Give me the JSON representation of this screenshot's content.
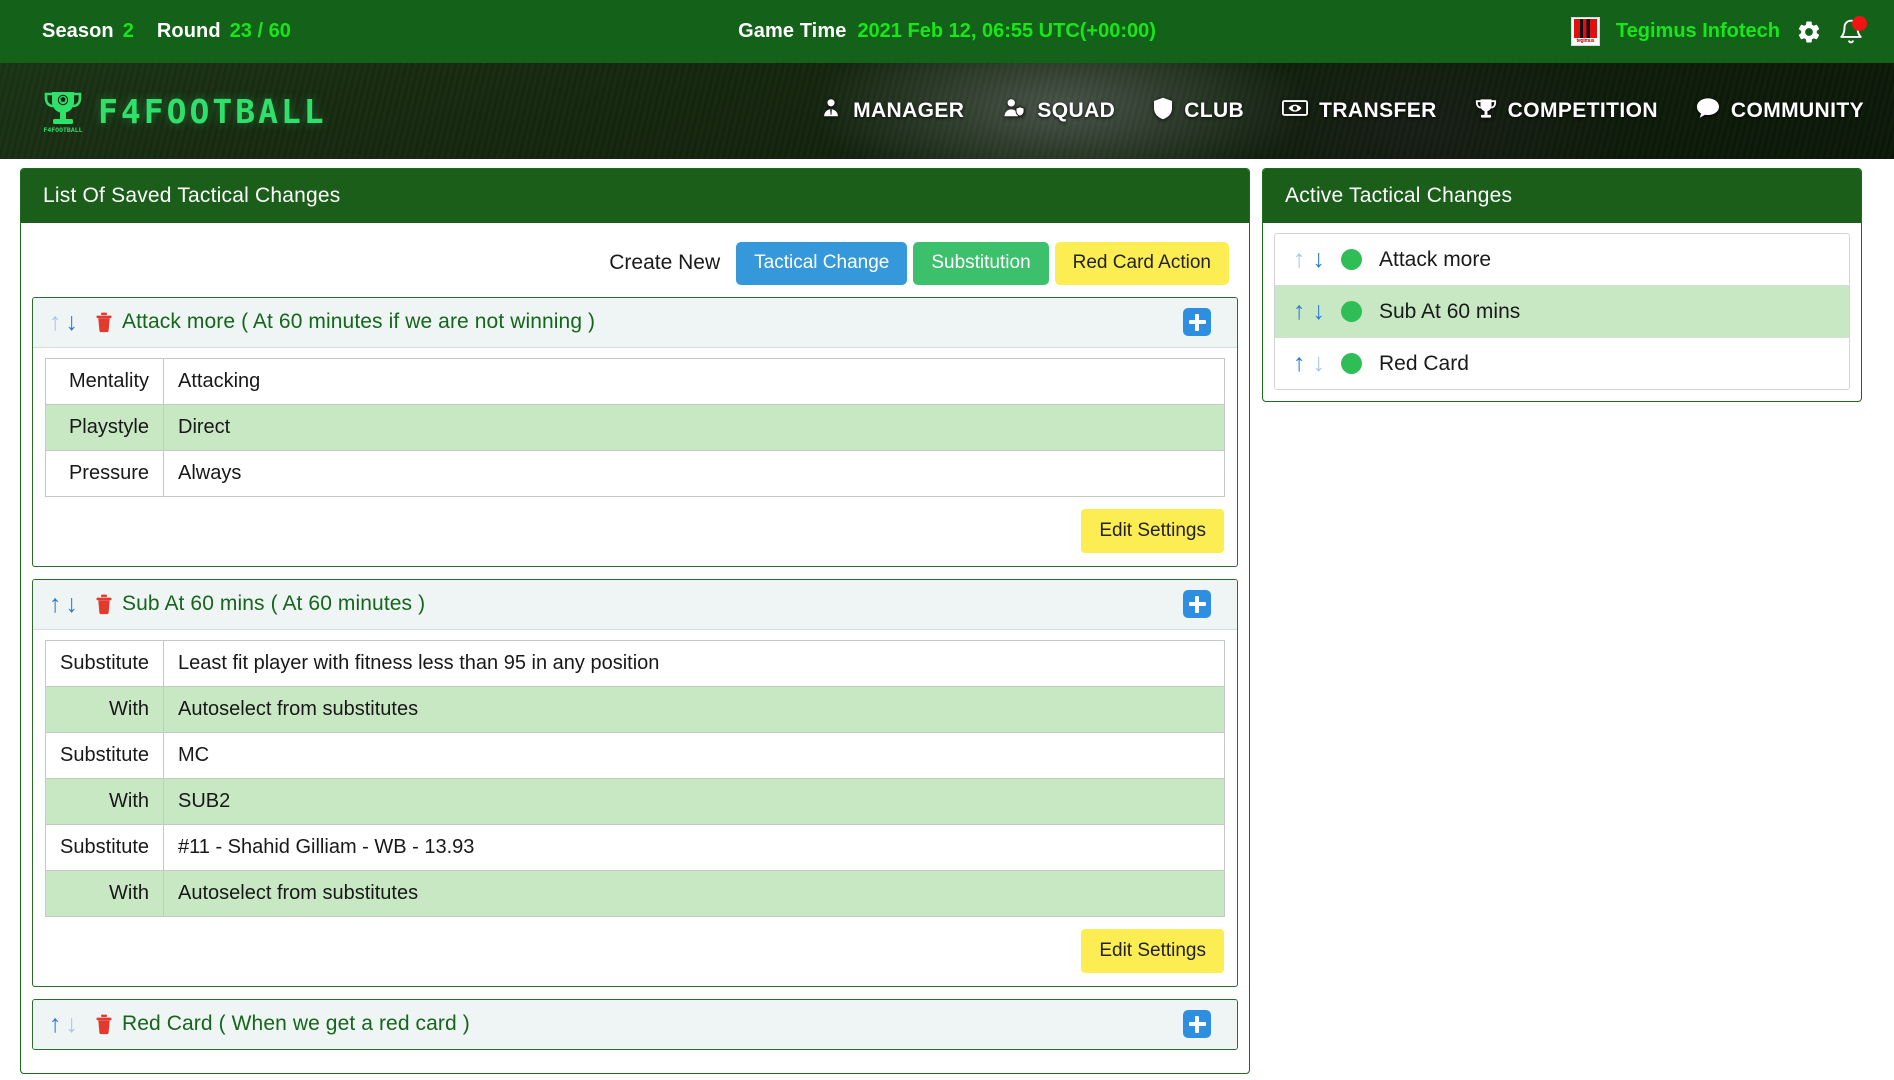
{
  "topbar": {
    "season_label": "Season",
    "season_value": "2",
    "round_label": "Round",
    "round_value": "23 / 60",
    "game_time_label": "Game Time",
    "game_time_value": "2021 Feb 12, 06:55 UTC(+00:00)",
    "club_name": "Tegimus Infotech",
    "club_logo_text": "tegimus",
    "gear_icon": "gear-icon",
    "bell_icon": "bell-icon"
  },
  "nav": {
    "brand": "F4FOOTBALL",
    "brand_sub": "F4FOOTBALL",
    "items": [
      {
        "label": "MANAGER",
        "icon": "manager-icon"
      },
      {
        "label": "SQUAD",
        "icon": "squad-icon"
      },
      {
        "label": "CLUB",
        "icon": "shield-icon"
      },
      {
        "label": "TRANSFER",
        "icon": "handshake-icon"
      },
      {
        "label": "COMPETITION",
        "icon": "trophy-icon"
      },
      {
        "label": "COMMUNITY",
        "icon": "chat-icon"
      }
    ]
  },
  "left_panel": {
    "title": "List Of Saved Tactical Changes",
    "create_new_label": "Create New",
    "buttons": {
      "tactical_change": "Tactical Change",
      "substitution": "Substitution",
      "red_card_action": "Red Card Action"
    },
    "edit_settings_label": "Edit Settings",
    "tactics": [
      {
        "title": "Attack more ( At 60 minutes if we are not winning )",
        "up_enabled": false,
        "down_enabled": true,
        "has_table": true,
        "rows": [
          {
            "key": "Mentality",
            "value": "Attacking"
          },
          {
            "key": "Playstyle",
            "value": "Direct"
          },
          {
            "key": "Pressure",
            "value": "Always"
          }
        ]
      },
      {
        "title": "Sub At 60 mins ( At 60 minutes )",
        "up_enabled": true,
        "down_enabled": true,
        "has_table": true,
        "rows": [
          {
            "key": "Substitute",
            "value": "Least fit player with fitness less than 95 in any position"
          },
          {
            "key": "With",
            "value": "Autoselect from substitutes"
          },
          {
            "key": "Substitute",
            "value": "MC"
          },
          {
            "key": "With",
            "value": "SUB2"
          },
          {
            "key": "Substitute",
            "value": "#11 - Shahid Gilliam - WB - 13.93"
          },
          {
            "key": "With",
            "value": "Autoselect from substitutes"
          }
        ]
      },
      {
        "title": "Red Card ( When we get a red card )",
        "up_enabled": true,
        "down_enabled": false,
        "has_table": false,
        "rows": []
      }
    ]
  },
  "right_panel": {
    "title": "Active Tactical Changes",
    "items": [
      {
        "label": "Attack more",
        "status_color": "#2fbd56",
        "up_enabled": false,
        "down_enabled": true
      },
      {
        "label": "Sub At 60 mins",
        "status_color": "#2fbd56",
        "up_enabled": true,
        "down_enabled": true
      },
      {
        "label": "Red Card",
        "status_color": "#2fbd56",
        "up_enabled": true,
        "down_enabled": false
      }
    ]
  },
  "colors": {
    "header_green": "#14621a",
    "panel_green": "#1a5e1a",
    "accent_green": "#19e619",
    "brand_green": "#2fe06a",
    "btn_blue": "#3498db",
    "btn_green": "#3cc06c",
    "btn_yellow": "#fced52",
    "row_alt": "#c7e8c3",
    "tactic_head_bg": "#eef5f4",
    "arrow_active": "#2e7bd6",
    "arrow_disabled": "#a9c8e8",
    "trash_red": "#e23b2e"
  }
}
